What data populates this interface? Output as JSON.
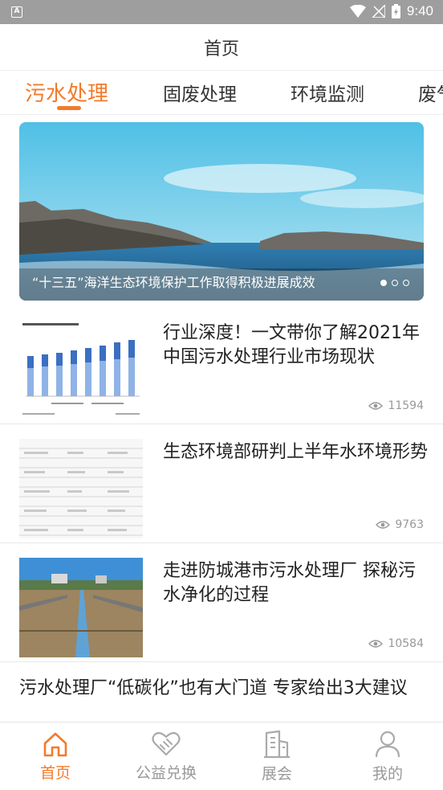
{
  "status_bar": {
    "time": "9:40",
    "app_badge": "A"
  },
  "header": {
    "title": "首页"
  },
  "tabs": [
    {
      "label": "污水处理",
      "active": true
    },
    {
      "label": "固废处理",
      "active": false
    },
    {
      "label": "环境监测",
      "active": false
    },
    {
      "label": "废气",
      "active": false
    }
  ],
  "banner": {
    "caption": "“十三五”海洋生态环境保护工作取得积极进展成效",
    "slide_count": 3,
    "current_slide": 1
  },
  "articles": [
    {
      "title": "行业深度！一文带你了解2021年中国污水处理行业市场现状",
      "views": "11594",
      "thumb_icon": "bar-chart-thumbnail"
    },
    {
      "title": "生态环境部研判上半年水环境形势",
      "views": "9763",
      "thumb_icon": "document-table-thumbnail"
    },
    {
      "title": "走进防城港市污水处理厂 探秘污水净化的过程",
      "views": "10584",
      "thumb_icon": "treatment-plant-photo"
    },
    {
      "title": "污水处理厂“低碳化”也有大门道 专家给出3大建议"
    }
  ],
  "bottom_nav": [
    {
      "label": "首页",
      "icon": "home-icon",
      "active": true
    },
    {
      "label": "公益兑换",
      "icon": "heart-hands-icon",
      "active": false
    },
    {
      "label": "展会",
      "icon": "building-icon",
      "active": false
    },
    {
      "label": "我的",
      "icon": "person-icon",
      "active": false
    }
  ],
  "colors": {
    "accent": "#f47a2a",
    "status_bar": "#9e9e9e",
    "muted_text": "#999999"
  }
}
